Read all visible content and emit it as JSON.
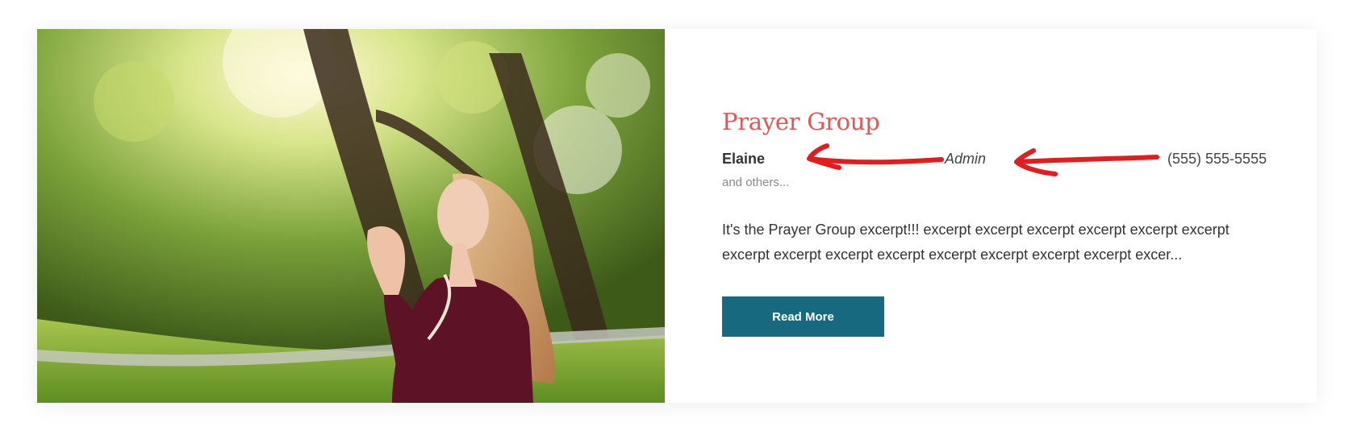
{
  "group": {
    "title": "Prayer Group",
    "leader_name": "Elaine",
    "leader_role": "Admin",
    "leader_phone": "(555) 555-5555",
    "others": "and others...",
    "excerpt": "It's the Prayer Group excerpt!!! excerpt excerpt excerpt excerpt excerpt excerpt excerpt excerpt excerpt excerpt excerpt excerpt excerpt excerpt excer...",
    "read_more_label": "Read More"
  },
  "colors": {
    "title": "#e35656",
    "button": "#17697f",
    "annotation_arrows": "#e31c1c"
  },
  "icons": {
    "annotation": "red-arrow-icon"
  }
}
